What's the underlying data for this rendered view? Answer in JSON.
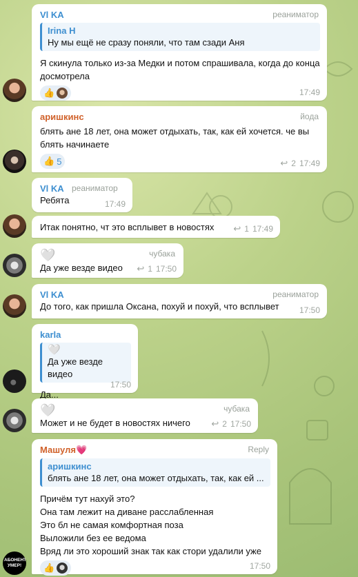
{
  "colors": {
    "vika": "#3e8fd0",
    "arishkins": "#d0612a",
    "karla": "#3e8fd0",
    "mashulya": "#d0612a",
    "accent": "#3e8fd0"
  },
  "messages": [
    {
      "author": "Vl KA",
      "tag": "реаниматор",
      "quote_name": "Irina H",
      "quote_text": "Ну мы ещё не сразу поняли, что там сзади Аня",
      "text": "Я скинула только из-за Медки и потом спрашивала, когда до конца досмотрела",
      "reaction_icon": "thumbs-up-icon",
      "reaction_glyph": "👍",
      "time": "17:49"
    },
    {
      "author": "аришкинс",
      "tag": "йода",
      "text": "блять ане 18 лет, она может отдыхать, так, как ей хочется. че вы блять начинаете",
      "reaction_glyph": "👍",
      "reaction_count": "5",
      "replies": "2",
      "time": "17:49"
    },
    {
      "author": "Vl KA",
      "tag": "реаниматор",
      "text": "Ребята",
      "time": "17:49"
    },
    {
      "text": "Итак понятно, чт это всплывет в новостях",
      "replies": "1",
      "time": "17:49"
    },
    {
      "heart": "🤍",
      "tag": "чубака",
      "text": "Да уже везде видео",
      "replies": "1",
      "time": "17:50"
    },
    {
      "author": "Vl KA",
      "tag": "реаниматор",
      "text": "До того, как пришла Оксана, похуй и похуй, что всплывет",
      "time": "17:50"
    },
    {
      "author": "karla",
      "quote_heart": "🤍",
      "quote_text": "Да уже везде видео",
      "text": "Да...",
      "time": "17:50"
    },
    {
      "heart": "🤍",
      "tag": "чубака",
      "text": "Может и не будет в новостях ничего",
      "replies": "2",
      "time": "17:50"
    },
    {
      "author": "Машуля",
      "author_heart": "💗",
      "tag": "Reply",
      "quote_name": "аришкинс",
      "quote_text": "блять ане 18 лет, она может отдыхать, так, как ей ...",
      "text": "Причём тут нахуй это?\nОна там лежит на диване расслабленная\nЭто бл не самая комфортная поза\nВыложили без ее ведома\nВряд ли это хороший знак так как стори удалили уже",
      "reaction_glyph": "👍",
      "time": "17:50"
    }
  ],
  "avatar_text": "АБОНЕНТ УМЕР!",
  "reply_glyph": "↩"
}
